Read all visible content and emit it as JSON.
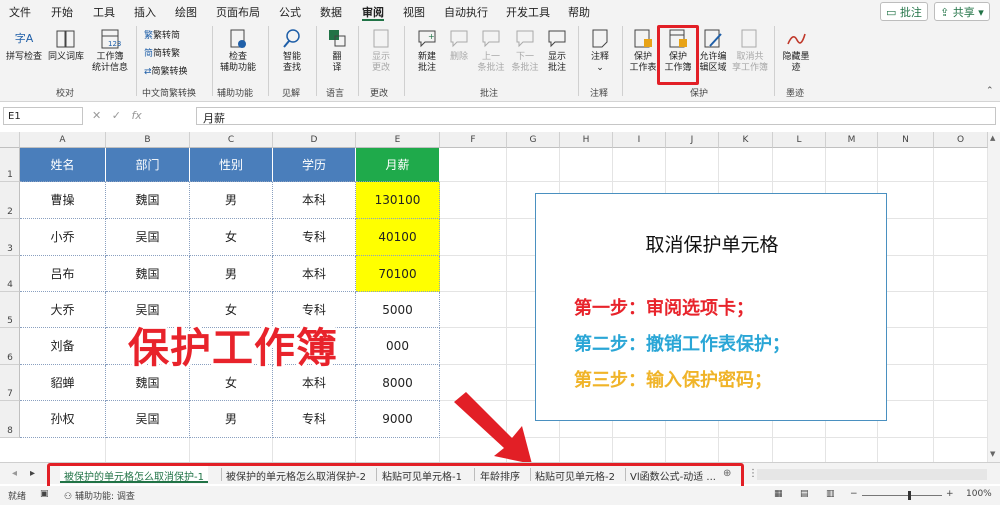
{
  "menu": {
    "items": [
      "文件",
      "开始",
      "工具",
      "插入",
      "绘图",
      "页面布局",
      "公式",
      "数据",
      "审阅",
      "视图",
      "自动执行",
      "开发工具",
      "帮助"
    ],
    "active": "审阅"
  },
  "topbar": {
    "comments_label": "批注",
    "share_label": "共享"
  },
  "ribbon": {
    "spell": "拼写检查",
    "thesaurus": "同义词库",
    "stats_1": "工作簿",
    "stats_2": "统计信息",
    "spell_icon_text": "字A",
    "trad": "繁转简",
    "simp": "简转繁",
    "conv": "简繁转换",
    "access_1": "检查",
    "access_2": "辅助功能",
    "smart_1": "智能",
    "smart_2": "查找",
    "translate_1": "翻",
    "translate_2": "译",
    "changes_1": "显示",
    "changes_2": "更改",
    "newc_1": "新建",
    "newc_2": "批注",
    "del": "删除",
    "prev_1": "上一",
    "prev_2": "条批注",
    "next_1": "下一",
    "next_2": "条批注",
    "show_1": "显示",
    "show_2": "批注",
    "notes": "注释",
    "psheet_1": "保护",
    "psheet_2": "工作表",
    "pbook_1": "保护",
    "pbook_2": "工作簿",
    "allow_1": "允许编",
    "allow_2": "辑区域",
    "unshare_1": "取消共",
    "unshare_2": "享工作簿",
    "ink_1": "隐藏墨",
    "ink_2": "迹",
    "groups": {
      "proof": "校对",
      "chinese": "中文简繁转换",
      "access": "辅助功能",
      "insights": "见解",
      "language": "语言",
      "changes": "更改",
      "comments": "批注",
      "notes": "注释",
      "protect": "保护",
      "ink": "墨迹"
    }
  },
  "formula_bar": {
    "cell_ref": "E1",
    "fx": "fx",
    "content": "月薪"
  },
  "grid": {
    "columns": [
      "A",
      "B",
      "C",
      "D",
      "E",
      "F",
      "G",
      "H",
      "I",
      "J",
      "K",
      "L",
      "M",
      "N",
      "O"
    ],
    "rows": [
      "1",
      "2",
      "3",
      "4",
      "5",
      "6",
      "7",
      "8"
    ],
    "headers": [
      "姓名",
      "部门",
      "性别",
      "学历",
      "月薪"
    ],
    "data": [
      [
        "曹操",
        "魏国",
        "男",
        "本科",
        "130100"
      ],
      [
        "小乔",
        "吴国",
        "女",
        "专科",
        "40100"
      ],
      [
        "吕布",
        "魏国",
        "男",
        "本科",
        "70100"
      ],
      [
        "大乔",
        "吴国",
        "女",
        "专科",
        "5000"
      ],
      [
        "刘备",
        "",
        "",
        "",
        "000"
      ],
      [
        "貂蝉",
        "魏国",
        "女",
        "本科",
        "8000"
      ],
      [
        "孙权",
        "吴国",
        "男",
        "专科",
        "9000"
      ]
    ],
    "highlighted_rows": [
      0,
      1,
      2
    ]
  },
  "textbox": {
    "title": "取消保护单元格",
    "steps": [
      {
        "text": "第一步：审阅选项卡；",
        "color": "#e8232b"
      },
      {
        "text": "第二步：撤销工作表保护；",
        "color": "#2aa6d6"
      },
      {
        "text": "第三步：输入保护密码；",
        "color": "#f0b429"
      }
    ]
  },
  "overlay_text": "保护工作簿",
  "overlay_color": "#e8232b",
  "tabs": [
    "被保护的单元格怎么取消保护-1",
    "被保护的单元格怎么取消保护-2",
    "粘贴可见单元格-1",
    "年龄排序",
    "粘贴可见单元格-2",
    "Vl函数公式-动适 ..."
  ],
  "active_tab": 0,
  "status": {
    "ready": "就绪",
    "accessibility": "辅助功能: 调查",
    "zoom": "100%"
  },
  "colors": {
    "accent": "#217346",
    "header_bg": "#4a7ebb",
    "highlight": "#ffff00",
    "callout": "#e21f26"
  }
}
